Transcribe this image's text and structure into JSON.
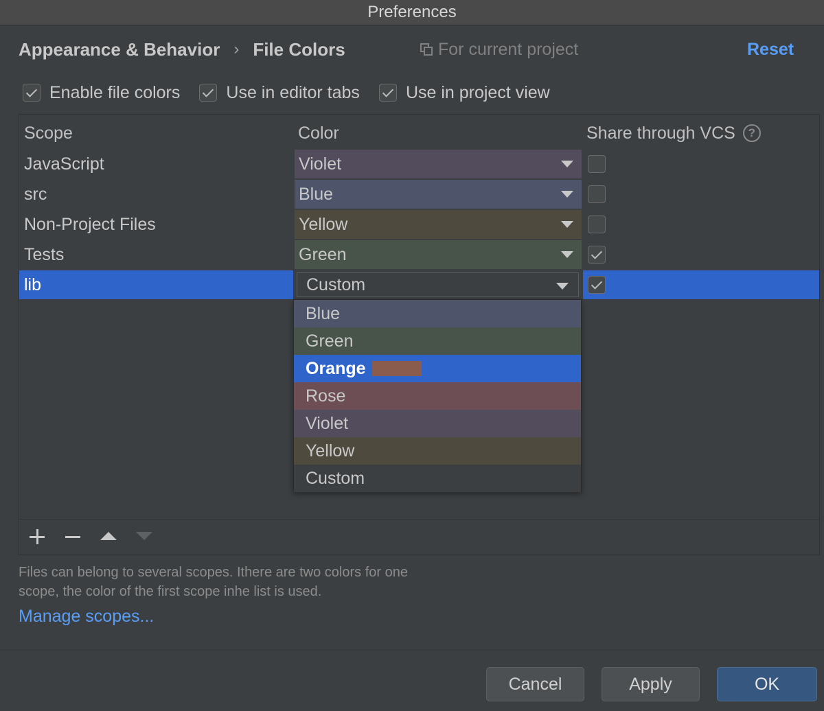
{
  "window": {
    "title": "Preferences"
  },
  "header": {
    "breadcrumb_parent": "Appearance & Behavior",
    "breadcrumb_separator": "›",
    "breadcrumb_current": "File Colors",
    "scope_note": "For current project",
    "reset_label": "Reset"
  },
  "options": [
    {
      "label": "Enable file colors",
      "checked": true
    },
    {
      "label": "Use in editor tabs",
      "checked": true
    },
    {
      "label": "Use in project view",
      "checked": true
    }
  ],
  "table": {
    "columns": {
      "scope": "Scope",
      "color": "Color",
      "vcs": "Share through VCS"
    },
    "help_glyph": "?",
    "rows": [
      {
        "scope": "JavaScript",
        "color": "Violet",
        "color_hex": "#534c5c",
        "shared": false,
        "selected": false
      },
      {
        "scope": "src",
        "color": "Blue",
        "color_hex": "#4e556b",
        "shared": false,
        "selected": false
      },
      {
        "scope": "Non-Project Files",
        "color": "Yellow",
        "color_hex": "#4f4a3e",
        "shared": false,
        "selected": false
      },
      {
        "scope": "Tests",
        "color": "Green",
        "color_hex": "#485449",
        "shared": true,
        "selected": false
      },
      {
        "scope": "lib",
        "color": "Custom",
        "color_hex": "#3b3f41",
        "shared": true,
        "selected": true
      }
    ]
  },
  "dropdown": {
    "items": [
      {
        "label": "Blue",
        "bg": "#4e556b",
        "active": false
      },
      {
        "label": "Green",
        "bg": "#485449",
        "active": false
      },
      {
        "label": "Orange",
        "bg": "#2f65ca",
        "active": true,
        "swatch": "#8a5c4d"
      },
      {
        "label": "Rose",
        "bg": "#6d4e55",
        "active": false
      },
      {
        "label": "Violet",
        "bg": "#534c5c",
        "active": false
      },
      {
        "label": "Yellow",
        "bg": "#4f4a3e",
        "active": false
      },
      {
        "label": "Custom",
        "bg": "#3c3f41",
        "active": false
      }
    ]
  },
  "hint": {
    "line1": "Files can belong to several scopes. Ithere are two colors for one",
    "line2": "scope, the color of the first scope inhe list is used."
  },
  "manage_scopes_label": "Manage scopes...",
  "buttons": {
    "cancel": "Cancel",
    "apply": "Apply",
    "ok": "OK"
  },
  "colors": {
    "accent": "#2f65ca",
    "link": "#589df6",
    "background": "#3c3f41"
  }
}
